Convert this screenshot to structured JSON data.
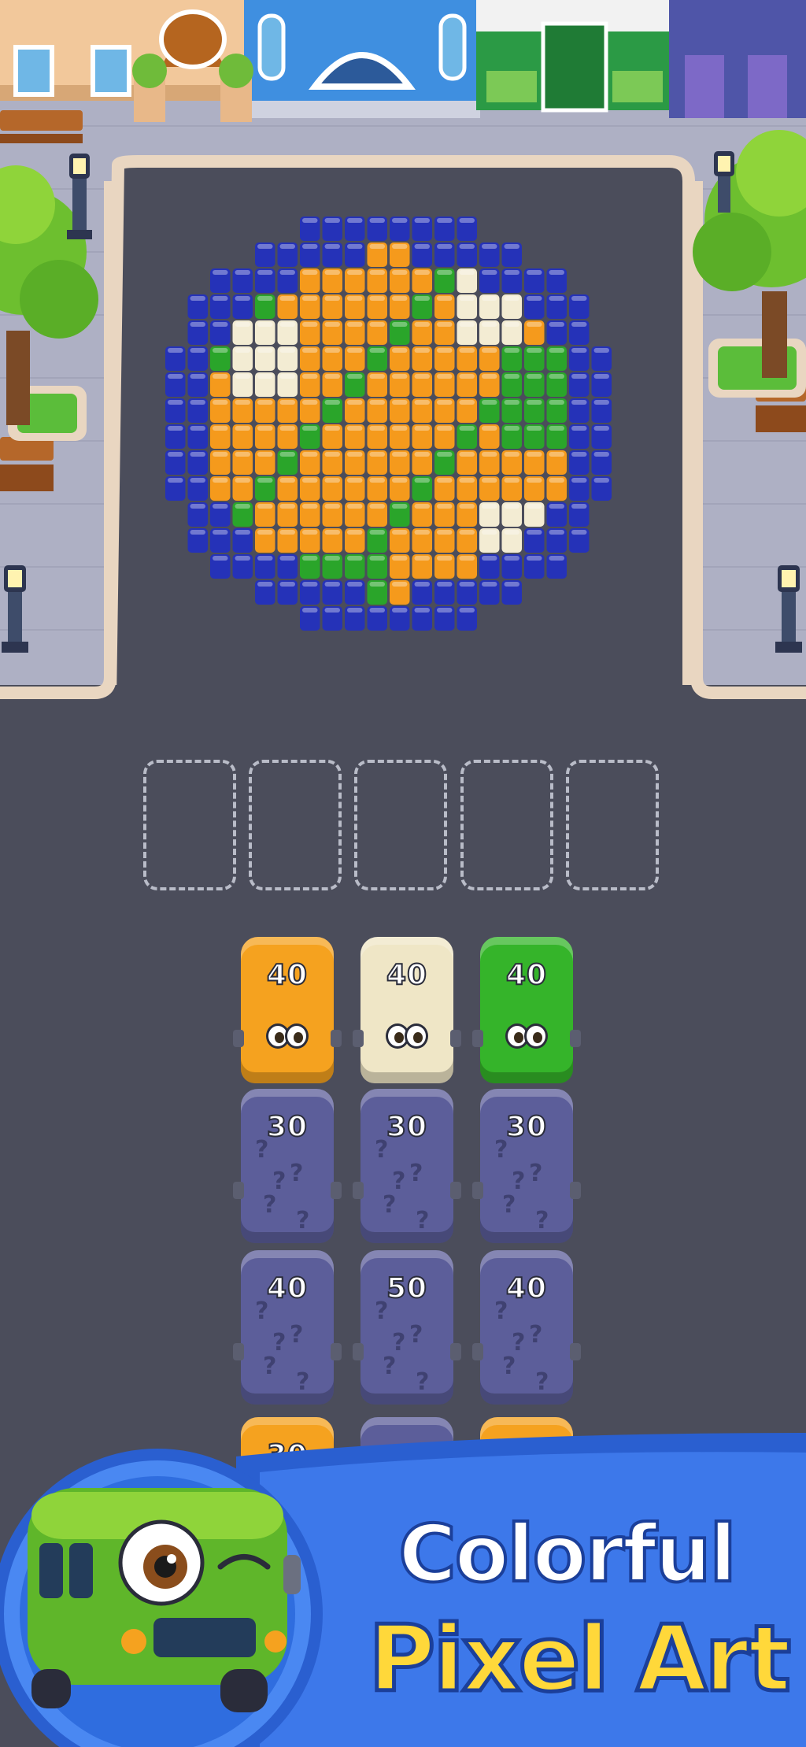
{
  "colors": {
    "orange_bus": "#f5a21f",
    "cream_bus": "#efe6c6",
    "green_bus": "#35b42a",
    "mystery_bus": "#5c5e9a",
    "pixel_blue": "#2532b8",
    "pixel_green": "#2aa52a",
    "pixel_orange": "#f59a1c",
    "pixel_cream": "#f3ecd3",
    "title_yellow": "#ffd83a",
    "banner_blue": "#2f6fe0"
  },
  "slots": [
    "",
    "",
    "",
    "",
    ""
  ],
  "queue": [
    [
      {
        "count": "40",
        "color": "orange"
      },
      {
        "count": "30",
        "color": "mystery"
      },
      {
        "count": "40",
        "color": "mystery"
      },
      {
        "count": "30",
        "color": "orange"
      }
    ],
    [
      {
        "count": "40",
        "color": "cream"
      },
      {
        "count": "30",
        "color": "mystery"
      },
      {
        "count": "50",
        "color": "mystery"
      },
      {
        "count": "",
        "color": "mystery"
      }
    ],
    [
      {
        "count": "40",
        "color": "green"
      },
      {
        "count": "30",
        "color": "mystery"
      },
      {
        "count": "40",
        "color": "mystery"
      },
      {
        "count": "",
        "color": "orange"
      }
    ]
  ],
  "banner": {
    "line1": "Colorful",
    "line2": "Pixel Art"
  },
  "icons": {
    "mascot": "green-bus-mascot-icon",
    "tree": "tree-icon",
    "lamp": "street-lamp-icon",
    "bench": "bench-icon"
  }
}
